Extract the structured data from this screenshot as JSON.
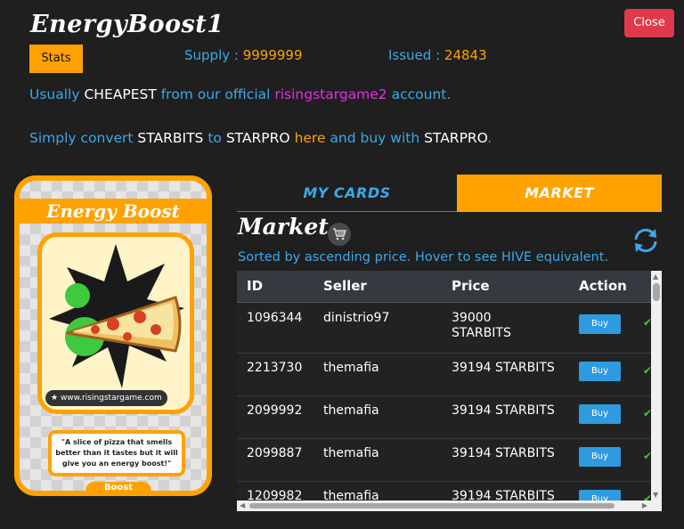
{
  "app": {
    "title": "EnergyBoost1",
    "close_label": "Close",
    "stats_label": "Stats"
  },
  "supply": {
    "label": "Supply : ",
    "value": "9999999"
  },
  "issued": {
    "label": "Issued : ",
    "value": "24843"
  },
  "info_line1": {
    "p1": "Usually ",
    "p2": "CHEAPEST",
    "p3": " from our official ",
    "p4": "risingstargame2",
    "p5": " account."
  },
  "info_line2": {
    "p1": "Simply convert ",
    "p2": "STARBITS",
    "p3": " to ",
    "p4": "STARPRO",
    "p5": " ",
    "p6": "here",
    "p7": " and buy with ",
    "p8": "STARPRO",
    "p9": "."
  },
  "card": {
    "title": "Energy Boost",
    "site": "www.risingstargame.com",
    "description": "\"A slice of pizza that smells better than it tastes but it will give you an energy boost!\"",
    "tag": "Boost"
  },
  "tabs": {
    "my_cards": "MY CARDS",
    "market": "MARKET"
  },
  "market": {
    "title": "Market",
    "sorted_note": "Sorted by ascending price. Hover to see HIVE equivalent.",
    "columns": {
      "id": "ID",
      "seller": "Seller",
      "price": "Price",
      "action": "Action"
    },
    "buy_label": "Buy",
    "rows": [
      {
        "id": "1096344",
        "seller": "dinistrio97",
        "price": "39000 STARBITS"
      },
      {
        "id": "2213730",
        "seller": "themafia",
        "price": "39194 STARBITS"
      },
      {
        "id": "2099992",
        "seller": "themafia",
        "price": "39194 STARBITS"
      },
      {
        "id": "2099887",
        "seller": "themafia",
        "price": "39194 STARBITS"
      },
      {
        "id": "1209982",
        "seller": "themafia",
        "price": "39194 STARBITS"
      }
    ]
  },
  "colors": {
    "accent_orange": "#ffa200",
    "link_blue": "#3ba8e8",
    "magenta": "#e030e0",
    "close_red": "#e0394b",
    "buy_blue": "#2e9be0"
  },
  "icons": [
    "shopping-cart-icon",
    "refresh-icon",
    "checkmark-icon",
    "star-icon"
  ]
}
